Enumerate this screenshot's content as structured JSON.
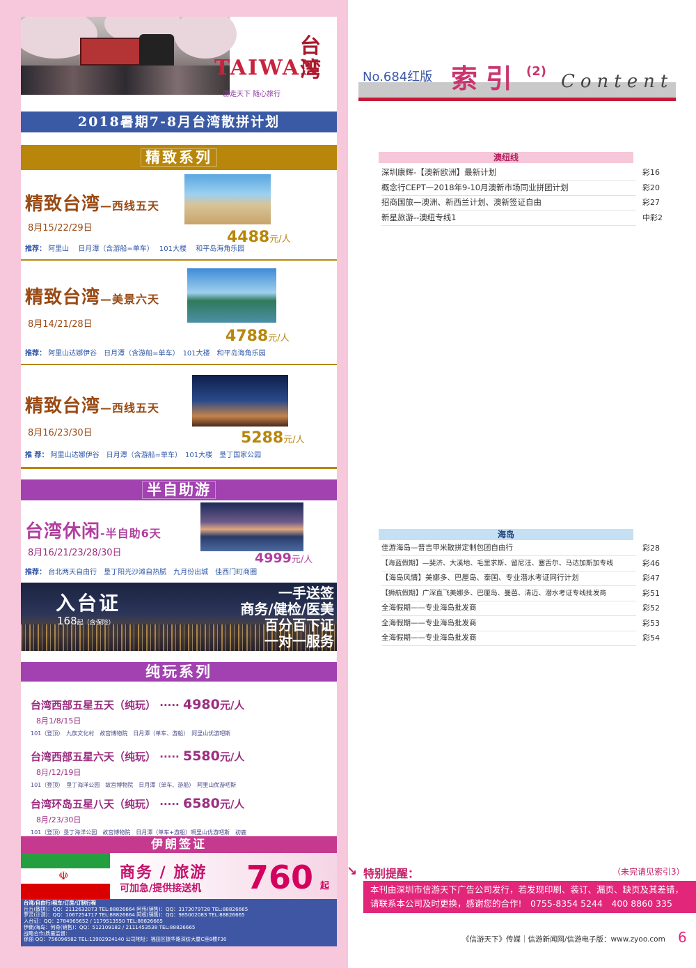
{
  "left_ad": {
    "logo_text": "TAIWAN",
    "logo_slogan": "游走天下 随心旅行",
    "logo_cn": "台湾",
    "plan_title": "2018暑期7-8月台湾散拼计划",
    "jingzhi_title": "精致系列",
    "tours": [
      {
        "title": "精致台湾",
        "suffix": "—西线五天",
        "dates": "8月15/22/29日",
        "price": "4488",
        "unit": "元/人",
        "rec_label": "推荐：",
        "rec": "阿里山　 日月潭（含游船=单车）　 101大楼　 和平岛海角乐园"
      },
      {
        "title": "精致台湾",
        "suffix": "—美景六天",
        "dates": "8月14/21/28日",
        "price": "4788",
        "unit": "元/人",
        "rec_label": "推荐：",
        "rec": "阿里山达娜伊谷　日月潭（含游船=单车）　101大楼　和平岛海角乐园"
      },
      {
        "title": "精致台湾",
        "suffix": "—西线五天",
        "dates": "8月16/23/30日",
        "price": "5288",
        "unit": "元/人",
        "rec_label": "推 荐：",
        "rec": "阿里山达娜伊谷　日月潭（含游船=单车）　101大楼　垦丁国家公园"
      }
    ],
    "banzi_title": "半自助游",
    "leisure": {
      "title": "台湾休闲",
      "suffix": "-半自助6天",
      "dates": "8月16/21/23/28/30日",
      "price": "4999",
      "unit": "元/人",
      "rec_label": "推荐：",
      "rec": "台北两天自由行　垦丁阳光沙滩自热腻　九月份出城　佳西门町商圈"
    },
    "permit": {
      "title": "入台证",
      "price": "168",
      "price_suffix": "起（含保险）",
      "lines": [
        "一手送签",
        "商务/健检/医美",
        "百分百下证",
        "一对一服务"
      ]
    },
    "chunwan_title": "纯玩系列",
    "chunwan": [
      {
        "title": "台湾西部五星五天（纯玩）",
        "dots": "·····",
        "price": "4980",
        "unit": "元/人",
        "dates": "8月1/8/15日",
        "rec": "101（登顶）　九族文化村　故宫博物院　日月潭（单车、游船）　阿里山优游吧斯"
      },
      {
        "title": "台湾西部五星六天（纯玩）",
        "dots": "·····",
        "price": "5580",
        "unit": "元/人",
        "dates": "8月/12/19日",
        "rec": "101（登顶）　垦丁海洋公园　故宫博物院　日月潭（单车、游船）　阿里山优游吧斯"
      },
      {
        "title": "台湾环岛五星八天（纯玩）",
        "dots": "·····",
        "price": "6580",
        "unit": "元/人",
        "dates": "8月/23/30日",
        "rec": "101（登顶）垦丁海洋公园　故宫博物院　日月潭（单车+游船）啊里山优游吧斯　初鹿"
      }
    ],
    "iran_title": "伊朗签证",
    "iran": {
      "line1": "商务 / 旅游",
      "line2": "可加急/提供接送机",
      "price": "760",
      "unit": "起",
      "flag_emblem": "☫"
    },
    "contact": [
      "台湾/自由行/租车/订房/订制行程",
      "丘丘(散拼)：QQ：2112632073  TEL:88826664        阿伟(销售)：QQ：3173079728  TEL:88826665",
      "罗灵(计调)：QQ：1067254717  TEL:88826664        阿权(销售)：QQ：985002083   TEL:88826665",
      "入台证：QQ：2784965652 / 1179513550  TEL:88826665",
      "伊朗/海岛：何奇(销售)：QQ：512109182 / 2111453538  TEL:88826665",
      "战略合作/质量监督：",
      "徐丽  QQ：756096582  TEL:13902924140     公司地址：福田区振华路深纺大厦C座8楼F30"
    ]
  },
  "header": {
    "issue": "No.684红版",
    "title": "索引",
    "part": "(2)",
    "content_word": "Content"
  },
  "sections": [
    {
      "name": "澳纽线",
      "items": [
        {
          "text": "深圳康辉-【澳新欧洲】最新计划",
          "page": "彩16"
        },
        {
          "text": "概念行CEPT—2018年9-10月澳新市场同业拼团计划",
          "page": "彩20"
        },
        {
          "text": "招商国旅—澳洲、新西兰计划、澳新签证自由",
          "page": "彩27"
        },
        {
          "text": "新星旅游--澳纽专线1",
          "page": "中彩2"
        }
      ]
    },
    {
      "name": "海岛",
      "items": [
        {
          "text": "佳游海岛—普吉甲米散拼定制包团自由行",
          "page": "彩28"
        },
        {
          "text": "【海蓝假期】—斐济、大溪地、毛里求斯、留尼汪、塞舌尔、马达加斯加专线",
          "page": "彩46"
        },
        {
          "text": "【海岛风情】美娜多、巴厘岛、泰国、专业潜水考证同行计划",
          "page": "彩47"
        },
        {
          "text": "【狮航假期】广深直飞美娜多、巴厘岛、曼芭、清迈、潜水考证专线批发商",
          "page": "彩51"
        },
        {
          "text": "全海假期——专业海岛批发商",
          "page": "彩52"
        },
        {
          "text": "全海假期——专业海岛批发商",
          "page": "彩53"
        },
        {
          "text": "全海假期——专业海岛批发商",
          "page": "彩54"
        }
      ]
    }
  ],
  "notice": {
    "arrow": "↘",
    "title": "特别提醒：",
    "more": "（未完请见索引3）",
    "line1": "本刊由深圳市信游天下广告公司发行，若发现印刷、装订、漏页、缺页及其差错，",
    "line2": "请联系本公司及时更换，感谢您的合作!　0755-8354 5244　400 8860 335"
  },
  "footer": {
    "text": "《信游天下》传媒｜信游新闻网/信游电子版：www.zyoo.com",
    "page": "6"
  }
}
